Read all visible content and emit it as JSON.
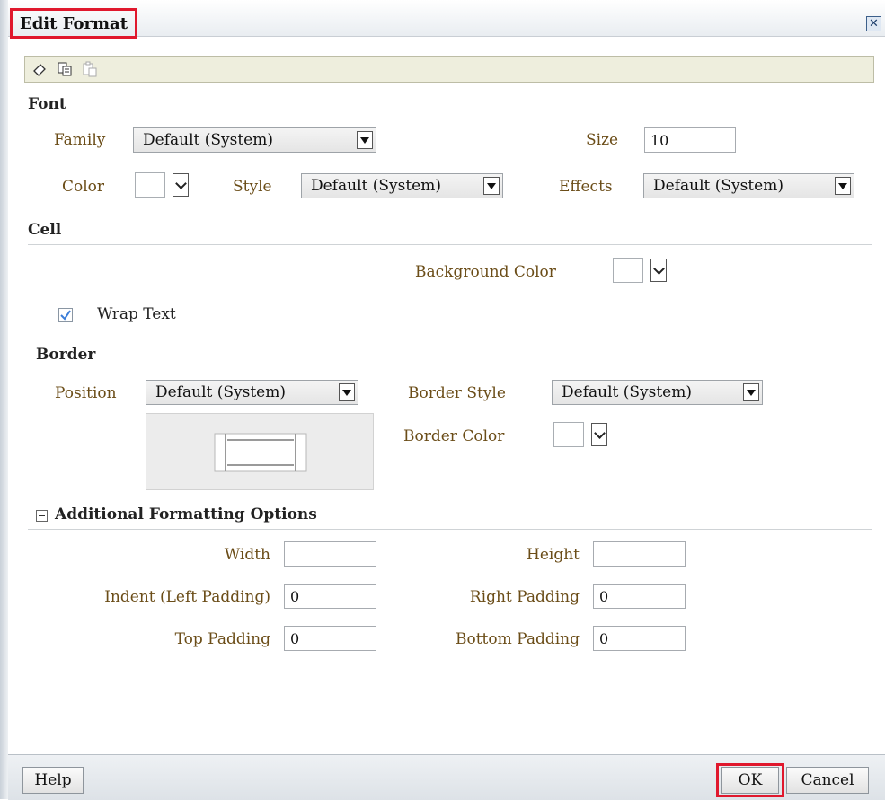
{
  "dialog": {
    "title": "Edit Format",
    "close_icon": "close-icon"
  },
  "toolbar": {
    "icons": [
      "eraser-icon",
      "copy-icon",
      "paste-icon"
    ]
  },
  "font": {
    "section_title": "Font",
    "family_label": "Family",
    "family_value": "Default (System)",
    "size_label": "Size",
    "size_value": "10",
    "color_label": "Color",
    "style_label": "Style",
    "style_value": "Default (System)",
    "effects_label": "Effects",
    "effects_value": "Default (System)"
  },
  "cell": {
    "section_title": "Cell",
    "background_color_label": "Background Color",
    "wrap_text_label": "Wrap Text",
    "wrap_text_checked": true
  },
  "border": {
    "section_title": "Border",
    "position_label": "Position",
    "position_value": "Default (System)",
    "border_style_label": "Border Style",
    "border_style_value": "Default (System)",
    "border_color_label": "Border Color"
  },
  "additional": {
    "section_title": "Additional Formatting Options",
    "width_label": "Width",
    "width_value": "",
    "height_label": "Height",
    "height_value": "",
    "indent_label": "Indent (Left Padding)",
    "indent_value": "0",
    "right_padding_label": "Right Padding",
    "right_padding_value": "0",
    "top_padding_label": "Top Padding",
    "top_padding_value": "0",
    "bottom_padding_label": "Bottom Padding",
    "bottom_padding_value": "0"
  },
  "footer": {
    "help_label": "Help",
    "ok_label": "OK",
    "cancel_label": "Cancel"
  },
  "colors": {
    "label": "#6b4d18",
    "highlight": "#e0182d",
    "toolbar_bg": "#eeeedd"
  }
}
